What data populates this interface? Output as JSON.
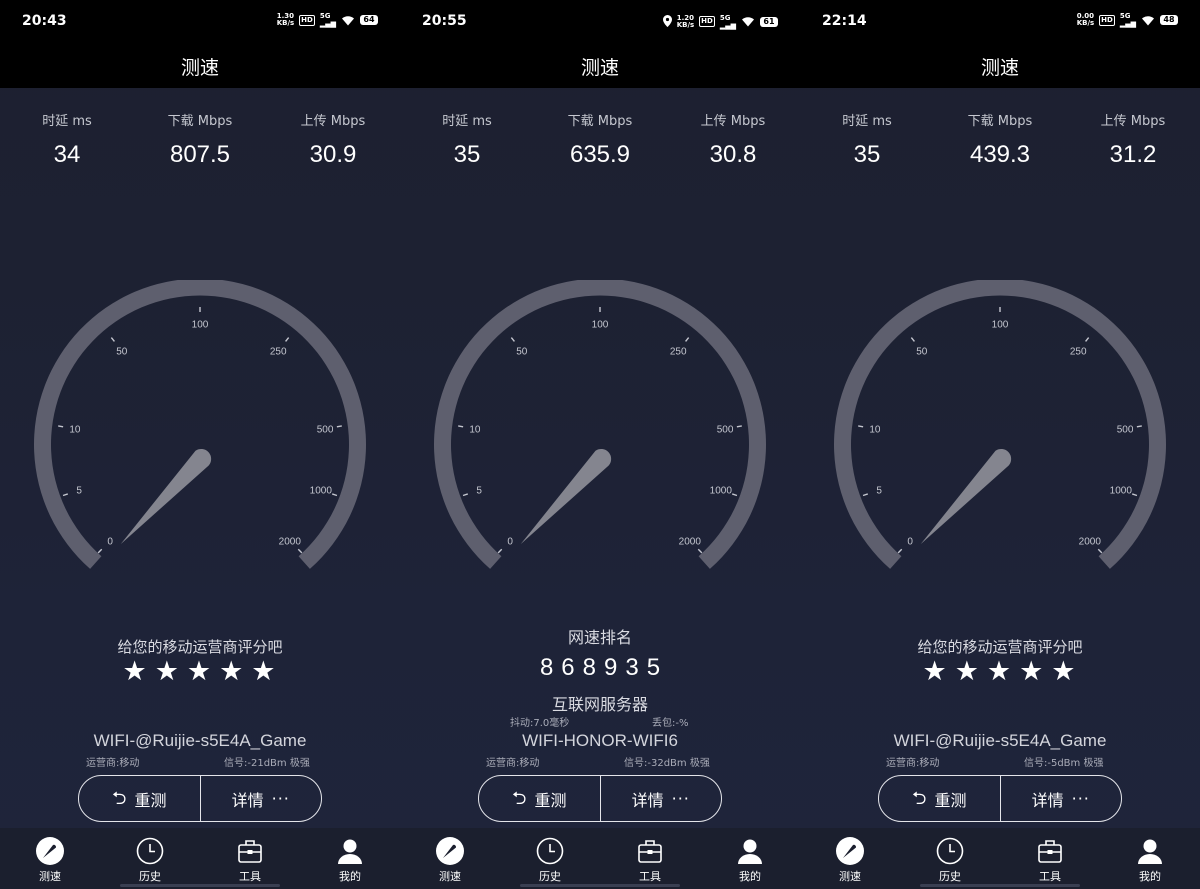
{
  "app_title": "测速",
  "metric_labels": {
    "latency": "时延 ms",
    "download": "下载 Mbps",
    "upload": "上传 Mbps"
  },
  "gauge_ticks": [
    "0",
    "5",
    "10",
    "50",
    "100",
    "250",
    "500",
    "1000",
    "2000"
  ],
  "rating": {
    "title": "给您的移动运营商评分吧",
    "stars": "★★★★★"
  },
  "rank": {
    "title": "网速排名",
    "value": "868935"
  },
  "buttons": {
    "retest": "重测",
    "details": "详情"
  },
  "nav": {
    "speedtest": "测速",
    "history": "历史",
    "tools": "工具",
    "me": "我的"
  },
  "colors": {
    "gauge_arc": "#5e5f6e",
    "needle": "#84858f",
    "background": "#1e2236"
  },
  "screens": [
    {
      "status": {
        "time": "20:43",
        "speed_value": "1.30",
        "speed_unit": "KB/s",
        "battery": "64"
      },
      "metrics": {
        "latency": "34",
        "download": "807.5",
        "upload": "30.9"
      },
      "wifi": {
        "name": "WIFI-@Ruijie-s5E4A_Game",
        "carrier": "运营商:移动",
        "signal": "信号:-21dBm 极强"
      }
    },
    {
      "status": {
        "time": "20:55",
        "speed_value": "1.20",
        "speed_unit": "KB/s",
        "battery": "61"
      },
      "metrics": {
        "latency": "35",
        "download": "635.9",
        "upload": "30.8"
      },
      "server": {
        "name": "互联网服务器",
        "jitter": "抖动:7.0毫秒",
        "loss": "丢包:-%"
      },
      "wifi": {
        "name": "WIFI-HONOR-WIFI6",
        "carrier": "运营商:移动",
        "signal": "信号:-32dBm 极强"
      }
    },
    {
      "status": {
        "time": "22:14",
        "speed_value": "0.00",
        "speed_unit": "KB/s",
        "battery": "48"
      },
      "metrics": {
        "latency": "35",
        "download": "439.3",
        "upload": "31.2"
      },
      "wifi": {
        "name": "WIFI-@Ruijie-s5E4A_Game",
        "carrier": "运营商:移动",
        "signal": "信号:-5dBm 极强"
      }
    }
  ]
}
